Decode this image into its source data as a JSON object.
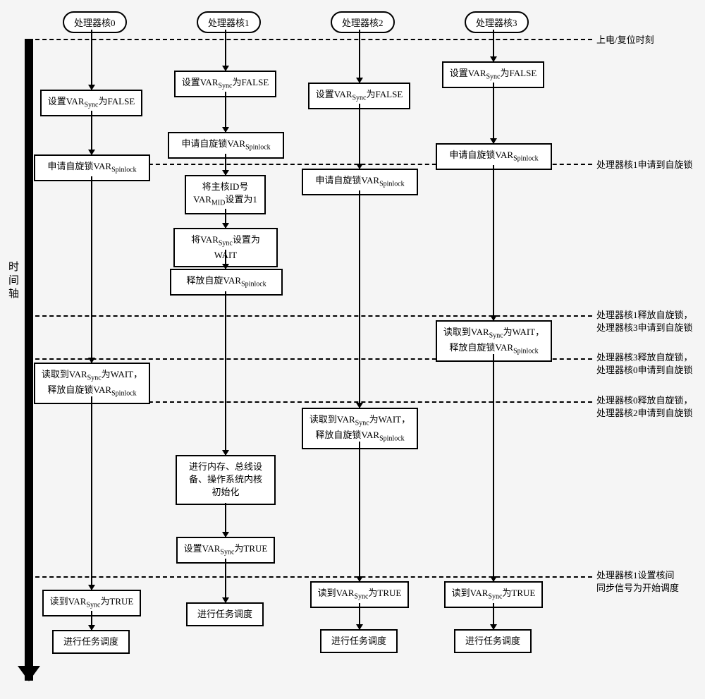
{
  "headers": {
    "core0": "处理器核0",
    "core1": "处理器核1",
    "core2": "处理器核2",
    "core3": "处理器核3"
  },
  "axis": "时间轴",
  "annotations": {
    "a1": "上电/复位时刻",
    "a2": "处理器核1申请到自旋锁",
    "a3": "处理器核1释放自旋锁，\n处理器核3申请到自旋锁",
    "a4": "处理器核3释放自旋锁，\n处理器核0申请到自旋锁",
    "a5": "处理器核0释放自旋锁，\n处理器核2申请到自旋锁",
    "a6": "处理器核1设置核间\n同步信号为开始调度"
  },
  "c0": {
    "b1_a": "设置VAR",
    "b1_b": "为FALSE",
    "b2_a": "申请自旋锁VAR",
    "b3_a": "读取到VAR",
    "b3_b": "为WAIT，",
    "b3_c": "释放自旋锁VAR",
    "b4_a": "读到VAR",
    "b4_b": "为TRUE",
    "b5": "进行任务调度"
  },
  "c1": {
    "b1_a": "设置VAR",
    "b1_b": "为FALSE",
    "b2_a": "申请自旋锁VAR",
    "b3_a": "将主核ID号",
    "b3_b": "VAR",
    "b3_c": "设置为1",
    "b4_a": "将VAR",
    "b4_b": "设置为WAIT",
    "b5_a": "释放自旋VAR",
    "b6": "进行内存、总线设\n备、操作系统内核\n初始化",
    "b7_a": "设置VAR",
    "b7_b": "为TRUE",
    "b8": "进行任务调度"
  },
  "c2": {
    "b1_a": "设置VAR",
    "b1_b": "为FALSE",
    "b2_a": "申请自旋锁VAR",
    "b3_a": "读取到VAR",
    "b3_b": "为WAIT，",
    "b3_c": "释放自旋锁VAR",
    "b4_a": "读到VAR",
    "b4_b": "为TRUE",
    "b5": "进行任务调度"
  },
  "c3": {
    "b1_a": "设置VAR",
    "b1_b": "为FALSE",
    "b2_a": "申请自旋锁VAR",
    "b3_a": "读取到VAR",
    "b3_b": "为WAIT，",
    "b3_c": "释放自旋锁VAR",
    "b4_a": "读到VAR",
    "b4_b": "为TRUE",
    "b5": "进行任务调度"
  },
  "sub": {
    "sync": "Sync",
    "spinlock": "Spinlock",
    "mid": "MID"
  }
}
